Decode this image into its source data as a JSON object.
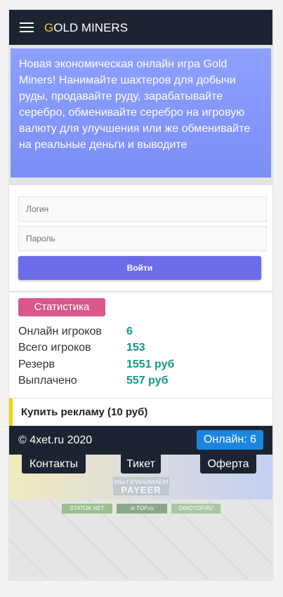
{
  "header": {
    "brand_first": "G",
    "brand_rest": "OLD MINERS"
  },
  "promo": {
    "text": "Новая экономическая онлайн игра Gold Miners! Нанимайте шахтеров для добычи руды, продавайте руду, зарабатывайте серебро, обменивайте серебро на игровую валюту для улучшения или же обменивайте на реальные деньги и выводите"
  },
  "login": {
    "login_placeholder": "Логин",
    "password_placeholder": "Пароль",
    "submit_label": "Войти"
  },
  "stats": {
    "button_label": "Статистика",
    "rows": [
      {
        "label": "Онлайн игроков",
        "value": "6"
      },
      {
        "label": "Всего игроков",
        "value": "153"
      },
      {
        "label": "Резерв",
        "value": "1551 руб"
      },
      {
        "label": "Выплачено",
        "value": "557 руб"
      }
    ]
  },
  "ad": {
    "label": "Купить рекламу (10 руб)"
  },
  "footer": {
    "copyright": "© 4xet.ru 2020",
    "online": "Онлайн: 6",
    "links": [
      "Контакты",
      "Тикет",
      "Оферта"
    ],
    "payeer_top": "МЫ ПРИНИМАЕМ",
    "payeer_brand": "PAYEER",
    "counters": [
      "STATOK.NET",
      "st.TOP.ru",
      "DINOTOP.RU"
    ]
  },
  "colors": {
    "header_bg": "#1d2431",
    "brand_accent": "#f6c23a",
    "login_button": "#6c6ce8",
    "stats_button": "#d9578b",
    "stat_value": "#16968a",
    "online_badge": "#1a86e0",
    "ad_accent": "#f5d100"
  }
}
